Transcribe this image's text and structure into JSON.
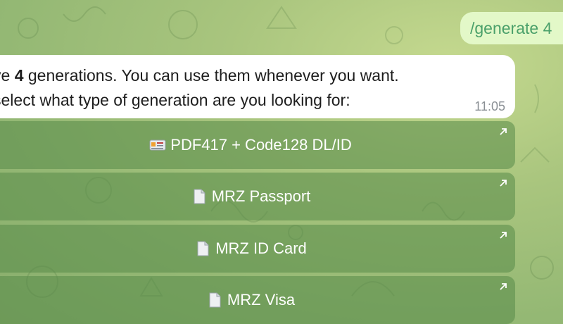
{
  "sent_message": {
    "text": "/generate 4"
  },
  "received_message": {
    "line1_before": "ve ",
    "line1_bold": "4",
    "line1_after": " generations. You can use them whenever you want.",
    "line2": "select what type of generation are you looking for:",
    "time": "11:05"
  },
  "keyboard": {
    "buttons": [
      {
        "icon": "id-card-icon",
        "label": "PDF417 + Code128 DL/ID"
      },
      {
        "icon": "document-icon",
        "label": "MRZ Passport"
      },
      {
        "icon": "document-icon",
        "label": "MRZ ID Card"
      },
      {
        "icon": "document-icon",
        "label": "MRZ Visa"
      }
    ]
  },
  "colors": {
    "background": "#a9c57e",
    "sent_bubble": "#e3f8c8",
    "sent_text": "#4aa06a",
    "button_bg": "#6f9a5c"
  }
}
